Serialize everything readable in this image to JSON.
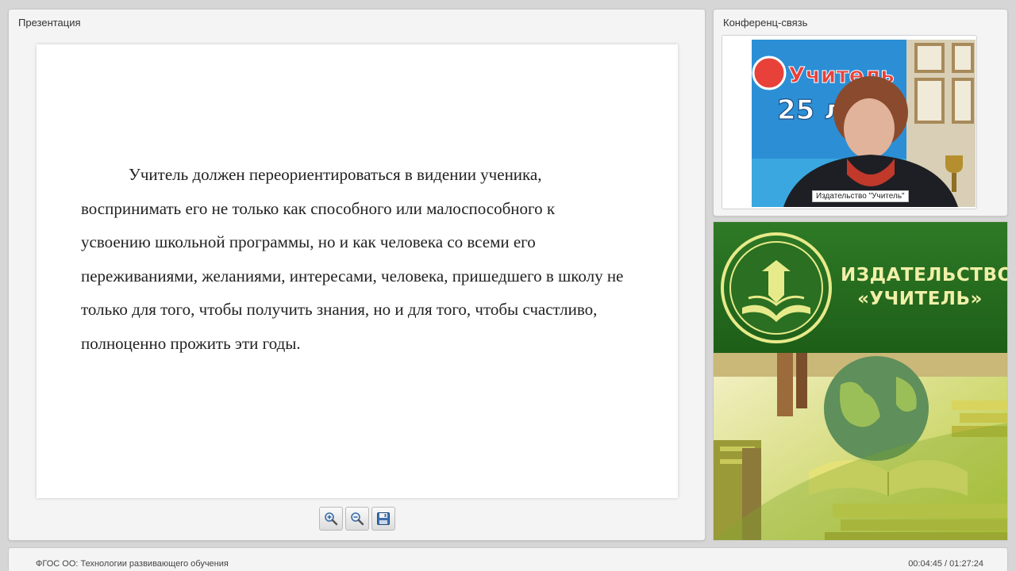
{
  "presentation": {
    "title": "Презентация",
    "slide_text": "Учитель должен переориентироваться в видении ученика, воспринимать его не только как способного или малоспособного к усвоению школьной программы, но и как человека со всеми его переживаниями, желаниями, интересами, человека, пришедшего в школу не только для того, чтобы получить знания, но и для того, чтобы счастливо, полноценно прожить эти годы.",
    "toolbar": {
      "zoom_in_icon": "magnifier-plus",
      "zoom_out_icon": "magnifier-minus",
      "save_icon": "floppy-disk"
    }
  },
  "conference": {
    "title": "Конференц-связь",
    "participant_label": "Издательство \"Учитель\"",
    "video_poster_text": {
      "brand": "Учитель",
      "years": "25 лет"
    }
  },
  "banner": {
    "line1": "ИЗДАТЕЛЬСТВО",
    "line2": "«УЧИТЕЛЬ»",
    "colors": {
      "green": "#2e7a26",
      "text": "#f1f0a8"
    }
  },
  "statusbar": {
    "course_title": "ФГОС ОО: Технологии развивающего обучения",
    "timer": "00:04:45 / 01:27:24"
  }
}
